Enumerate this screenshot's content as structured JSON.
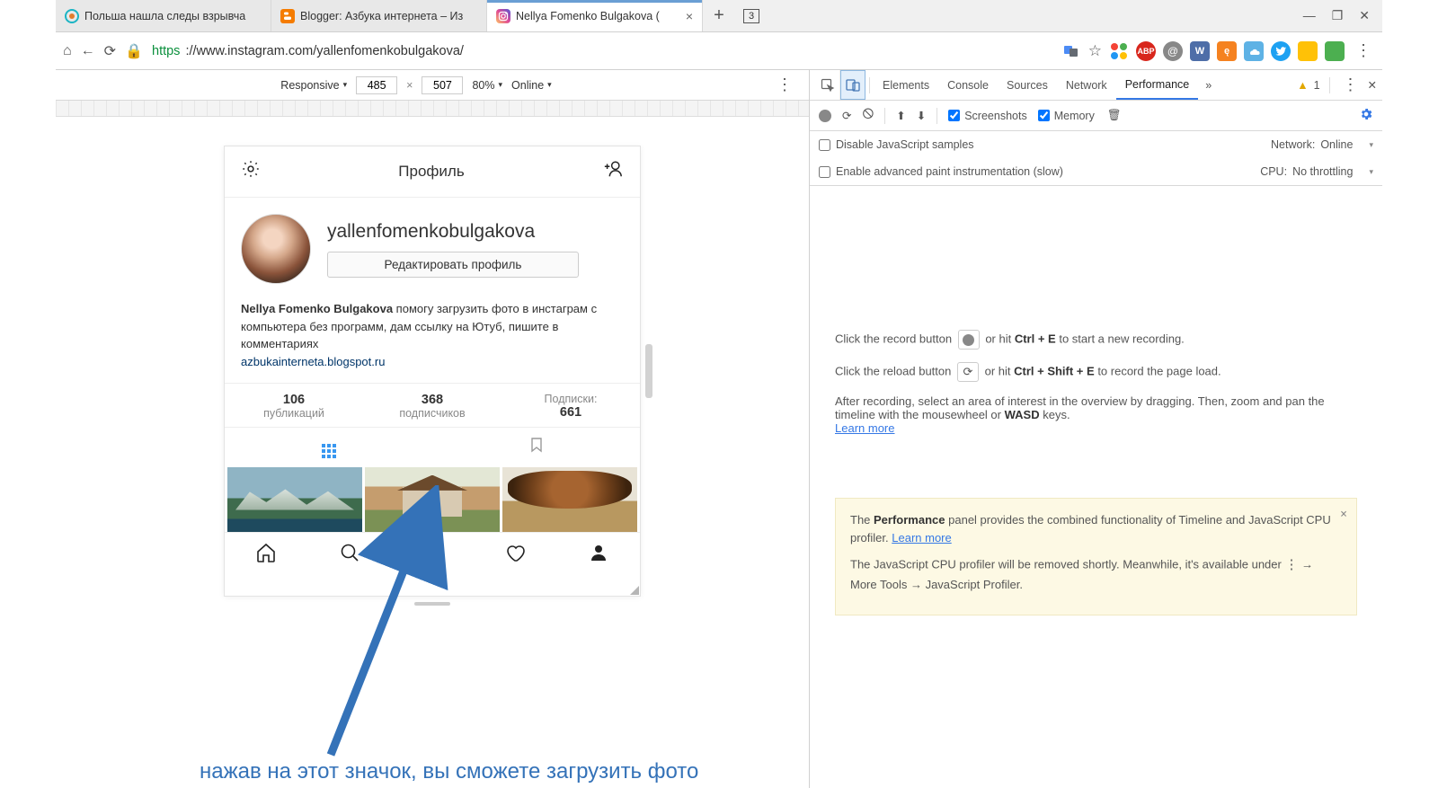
{
  "tabs": [
    {
      "title": "Польша нашла следы взрывча"
    },
    {
      "title": "Blogger: Азбука интернета – Из"
    },
    {
      "title": "Nellya Fomenko Bulgakova ("
    }
  ],
  "tab_counter": "3",
  "url_secure": "https",
  "url_rest": "://www.instagram.com/yallenfomenkobulgakova/",
  "device_toolbar": {
    "device": "Responsive",
    "w": "485",
    "h": "507",
    "zoom": "80%",
    "network": "Online"
  },
  "ig": {
    "header_title": "Профиль",
    "username": "yallenfomenkobulgakova",
    "edit_label": "Редактировать профиль",
    "bio_name": "Nellya Fomenko Bulgakova",
    "bio_text": " помогу загрузить фото в инстаграм с компьютера без программ, дам ссылку на Ютуб, пишите в комментариях",
    "bio_link": "azbukainterneta.blogspot.ru",
    "stats": [
      {
        "num": "106",
        "label": "публикаций"
      },
      {
        "num": "368",
        "label": "подписчиков"
      },
      {
        "num": "661",
        "label": "Подписки:"
      }
    ]
  },
  "caption": "нажав на этот значок, вы сможете загрузить фото",
  "devtools": {
    "tabs": [
      "Elements",
      "Console",
      "Sources",
      "Network",
      "Performance"
    ],
    "overflow": "»",
    "warn_count": "1",
    "perf_toolbar": {
      "screenshots": "Screenshots",
      "memory": "Memory"
    },
    "settings": {
      "disable_js": "Disable JavaScript samples",
      "advanced_paint": "Enable advanced paint instrumentation (slow)",
      "network_label": "Network:",
      "network_value": "Online",
      "cpu_label": "CPU:",
      "cpu_value": "No throttling"
    },
    "body": {
      "l1a": "Click the record button ",
      "l1b": " or hit ",
      "l1c": "Ctrl + E",
      "l1d": " to start a new recording.",
      "l2a": "Click the reload button ",
      "l2b": " or hit ",
      "l2c": "Ctrl + Shift + E",
      "l2d": " to record the page load.",
      "l3a": "After recording, select an area of interest in the overview by dragging. Then, zoom and pan the timeline with the mousewheel or ",
      "l3b": "WASD",
      "l3c": " keys.",
      "learn_more": "Learn more",
      "info1a": "The ",
      "info1b": "Performance",
      "info1c": " panel provides the combined functionality of Timeline and JavaScript CPU profiler. ",
      "info2": "The JavaScript CPU profiler will be removed shortly. Meanwhile, it's available under ",
      "info2b": " → More Tools → JavaScript Profiler."
    }
  }
}
